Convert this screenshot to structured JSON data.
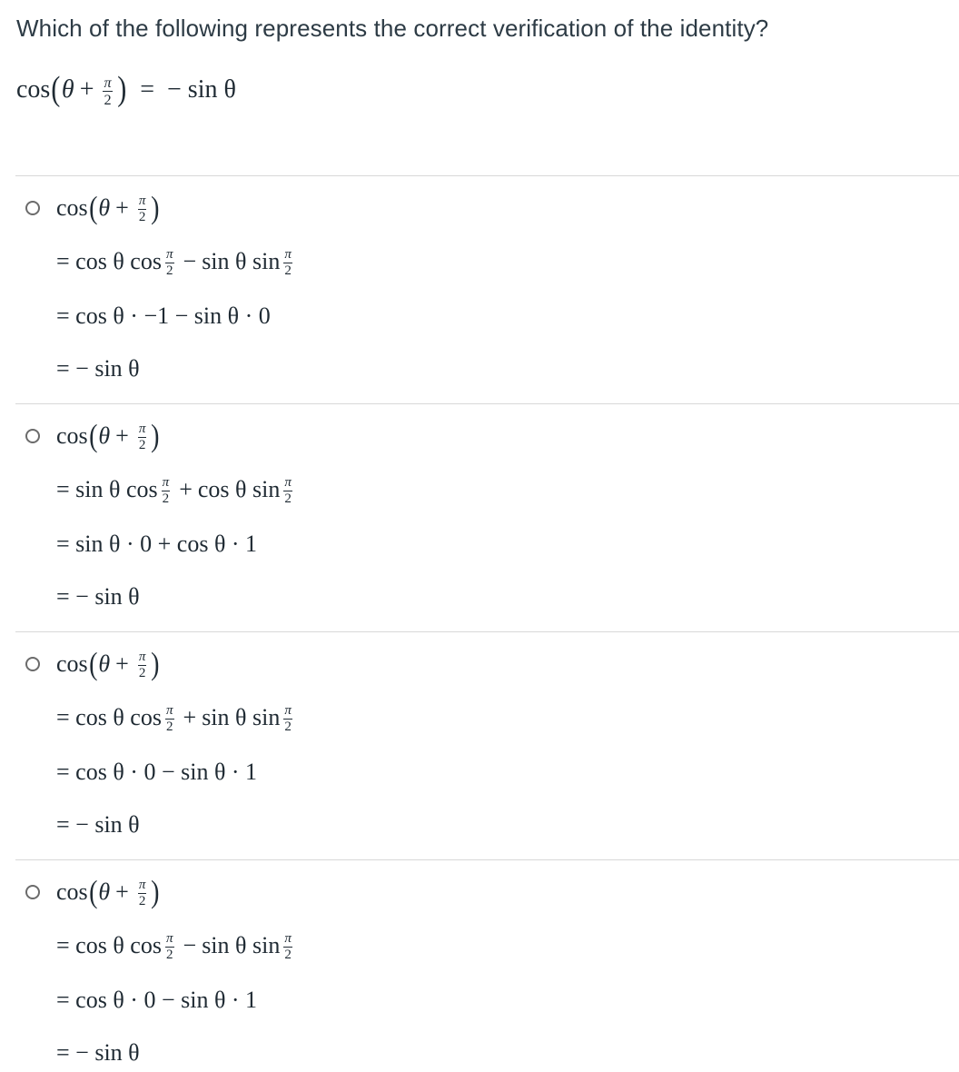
{
  "question": {
    "text": "Which of the following represents the correct verification of the identity?",
    "identity": {
      "lhs_fn": "cos",
      "var": "θ",
      "plus": "+",
      "frac_num": "π",
      "frac_den": "2",
      "eq": "=",
      "rhs": "− sin θ"
    }
  },
  "options": [
    {
      "selected": false,
      "head": {
        "fn": "cos",
        "var": "θ",
        "plus": "+",
        "num": "π",
        "den": "2"
      },
      "step1": {
        "eq": "=",
        "t1": "cos θ cos",
        "op": "−",
        "t2": "sin θ sin",
        "num": "π",
        "den": "2"
      },
      "step2": {
        "eq": "=",
        "text": "cos θ · −1 − sin θ · 0"
      },
      "step3": {
        "eq": "=",
        "text": "− sin θ"
      }
    },
    {
      "selected": false,
      "head": {
        "fn": "cos",
        "var": "θ",
        "plus": "+",
        "num": "π",
        "den": "2"
      },
      "step1": {
        "eq": "=",
        "t1": "sin θ cos",
        "op": "+",
        "t2": "cos θ sin",
        "num": "π",
        "den": "2"
      },
      "step2": {
        "eq": "=",
        "text": "sin θ · 0 + cos θ · 1"
      },
      "step3": {
        "eq": "=",
        "text": "− sin θ"
      }
    },
    {
      "selected": false,
      "head": {
        "fn": "cos",
        "var": "θ",
        "plus": "+",
        "num": "π",
        "den": "2"
      },
      "step1": {
        "eq": "=",
        "t1": "cos θ cos",
        "op": "+",
        "t2": "sin θ sin",
        "num": "π",
        "den": "2"
      },
      "step2": {
        "eq": "=",
        "text": "cos θ · 0 − sin θ · 1"
      },
      "step3": {
        "eq": "=",
        "text": "− sin θ"
      }
    },
    {
      "selected": false,
      "head": {
        "fn": "cos",
        "var": "θ",
        "plus": "+",
        "num": "π",
        "den": "2"
      },
      "step1": {
        "eq": "=",
        "t1": "cos θ cos",
        "op": "−",
        "t2": "sin θ sin",
        "num": "π",
        "den": "2"
      },
      "step2": {
        "eq": "=",
        "text": "cos θ · 0 − sin θ · 1"
      },
      "step3": {
        "eq": "=",
        "text": "− sin θ"
      }
    }
  ]
}
